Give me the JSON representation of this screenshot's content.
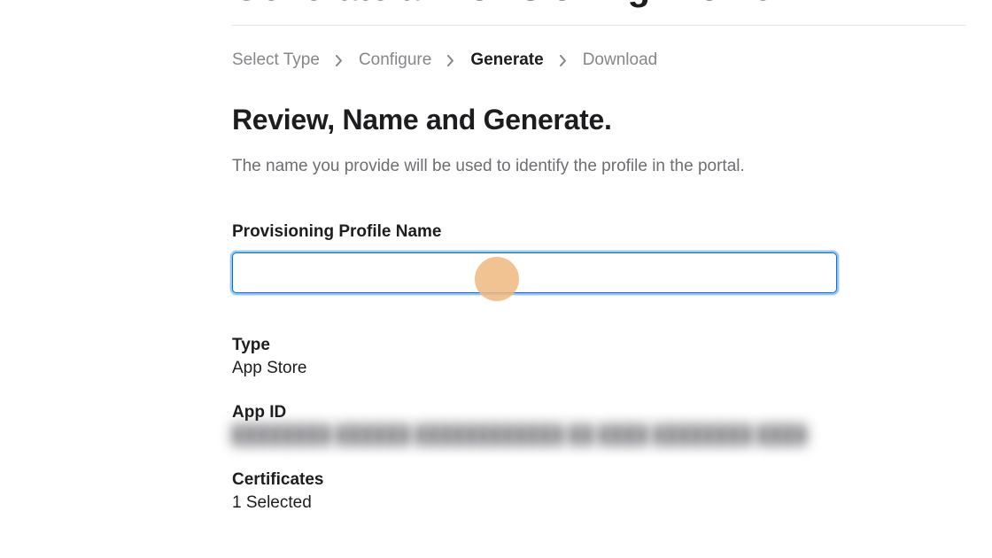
{
  "page_title": "Generate a Provisioning Profile",
  "breadcrumb": {
    "steps": [
      {
        "label": "Select Type",
        "active": false
      },
      {
        "label": "Configure",
        "active": false
      },
      {
        "label": "Generate",
        "active": true
      },
      {
        "label": "Download",
        "active": false
      }
    ]
  },
  "section": {
    "heading": "Review, Name and Generate.",
    "description": "The name you provide will be used to identify the profile in the portal."
  },
  "form": {
    "name_label": "Provisioning Profile Name",
    "name_value": "",
    "name_placeholder": ""
  },
  "info": {
    "type_label": "Type",
    "type_value": "App Store",
    "appid_label": "App ID",
    "appid_value": "████████ ██████ ████████████ ██ ████ ████████ ████",
    "certs_label": "Certificates",
    "certs_value": "1 Selected"
  }
}
